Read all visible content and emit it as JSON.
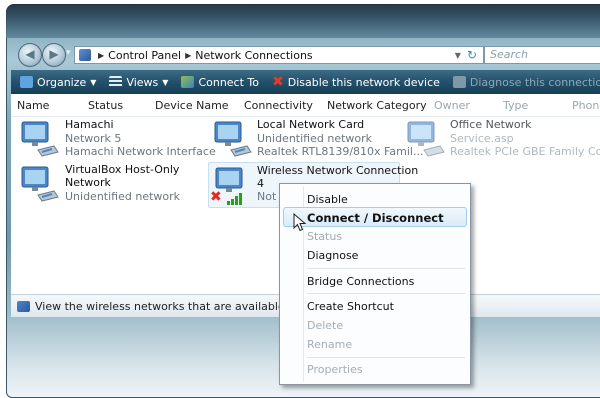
{
  "window": {
    "breadcrumb": [
      "Control Panel",
      "Network Connections"
    ],
    "search_placeholder": "Search"
  },
  "toolbar": {
    "organize": "Organize",
    "views": "Views",
    "connect_to": "Connect To",
    "disable_device": "Disable this network device",
    "diagnose": "Diagnose this connection"
  },
  "columns": [
    "Name",
    "Status",
    "Device Name",
    "Connectivity",
    "Network Category",
    "Owner",
    "Type",
    "Phone"
  ],
  "connections": [
    {
      "title": "Hamachi",
      "line2": "Network 5",
      "line3": "Hamachi Network Interface"
    },
    {
      "title": "Local Network Card",
      "line2": "Unidentified network",
      "line3": "Realtek RTL8139/810x Famil..."
    },
    {
      "title": "Office Network",
      "line2": "Service.asp",
      "line3": "Realtek PCIe GBE Family Co..."
    },
    {
      "title": "VirtualBox Host-Only",
      "line2": "Network",
      "line3": "Unidentified network"
    },
    {
      "title": "Wireless Network Connection",
      "line2": "4",
      "line3": "Not"
    }
  ],
  "statusbar": {
    "text": "View the wireless networks that are available from you"
  },
  "context_menu": {
    "items": [
      {
        "label": "Disable",
        "enabled": true
      },
      {
        "label": "Connect / Disconnect",
        "enabled": true,
        "default": true
      },
      {
        "label": "Status",
        "enabled": false
      },
      {
        "label": "Diagnose",
        "enabled": true
      },
      {
        "label": "Bridge Connections",
        "enabled": true
      },
      {
        "label": "Create Shortcut",
        "enabled": true
      },
      {
        "label": "Delete",
        "enabled": false
      },
      {
        "label": "Rename",
        "enabled": false
      },
      {
        "label": "Properties",
        "enabled": false
      }
    ]
  }
}
